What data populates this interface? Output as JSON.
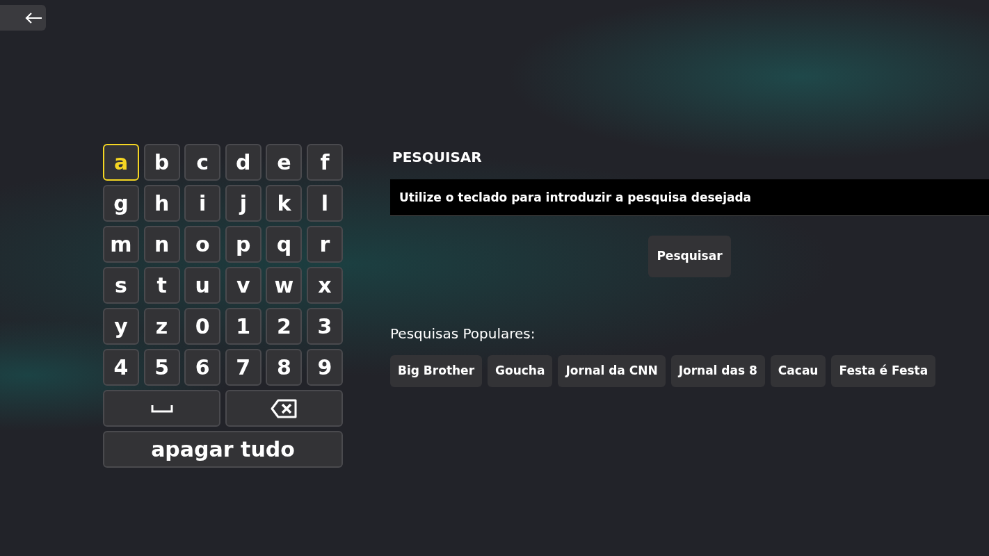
{
  "keyboard": {
    "keys": [
      {
        "kind": "char",
        "label": "a",
        "selected": true
      },
      {
        "kind": "char",
        "label": "b",
        "selected": false
      },
      {
        "kind": "char",
        "label": "c",
        "selected": false
      },
      {
        "kind": "char",
        "label": "d",
        "selected": false
      },
      {
        "kind": "char",
        "label": "e",
        "selected": false
      },
      {
        "kind": "char",
        "label": "f",
        "selected": false
      },
      {
        "kind": "char",
        "label": "g",
        "selected": false
      },
      {
        "kind": "char",
        "label": "h",
        "selected": false
      },
      {
        "kind": "char",
        "label": "i",
        "selected": false
      },
      {
        "kind": "char",
        "label": "j",
        "selected": false
      },
      {
        "kind": "char",
        "label": "k",
        "selected": false
      },
      {
        "kind": "char",
        "label": "l",
        "selected": false
      },
      {
        "kind": "char",
        "label": "m",
        "selected": false
      },
      {
        "kind": "char",
        "label": "n",
        "selected": false
      },
      {
        "kind": "char",
        "label": "o",
        "selected": false
      },
      {
        "kind": "char",
        "label": "p",
        "selected": false
      },
      {
        "kind": "char",
        "label": "q",
        "selected": false
      },
      {
        "kind": "char",
        "label": "r",
        "selected": false
      },
      {
        "kind": "char",
        "label": "s",
        "selected": false
      },
      {
        "kind": "char",
        "label": "t",
        "selected": false
      },
      {
        "kind": "char",
        "label": "u",
        "selected": false
      },
      {
        "kind": "char",
        "label": "v",
        "selected": false
      },
      {
        "kind": "char",
        "label": "w",
        "selected": false
      },
      {
        "kind": "char",
        "label": "x",
        "selected": false
      },
      {
        "kind": "char",
        "label": "y",
        "selected": false
      },
      {
        "kind": "char",
        "label": "z",
        "selected": false
      },
      {
        "kind": "char",
        "label": "0",
        "selected": false
      },
      {
        "kind": "char",
        "label": "1",
        "selected": false
      },
      {
        "kind": "char",
        "label": "2",
        "selected": false
      },
      {
        "kind": "char",
        "label": "3",
        "selected": false
      },
      {
        "kind": "char",
        "label": "4",
        "selected": false
      },
      {
        "kind": "char",
        "label": "5",
        "selected": false
      },
      {
        "kind": "char",
        "label": "6",
        "selected": false
      },
      {
        "kind": "char",
        "label": "7",
        "selected": false
      },
      {
        "kind": "char",
        "label": "8",
        "selected": false
      },
      {
        "kind": "char",
        "label": "9",
        "selected": false
      },
      {
        "kind": "space",
        "selected": false
      },
      {
        "kind": "backspace",
        "selected": false
      },
      {
        "kind": "wide",
        "label": "apagar tudo",
        "selected": false
      }
    ]
  },
  "search": {
    "title": "PESQUISAR",
    "placeholder": "Utilize o teclado para introduzir a pesquisa desejada",
    "button": "Pesquisar"
  },
  "popular": {
    "heading": "Pesquisas Populares:",
    "items": [
      "Big Brother",
      "Goucha",
      "Jornal da CNN",
      "Jornal das 8",
      "Cacau",
      "Festa é Festa"
    ]
  }
}
